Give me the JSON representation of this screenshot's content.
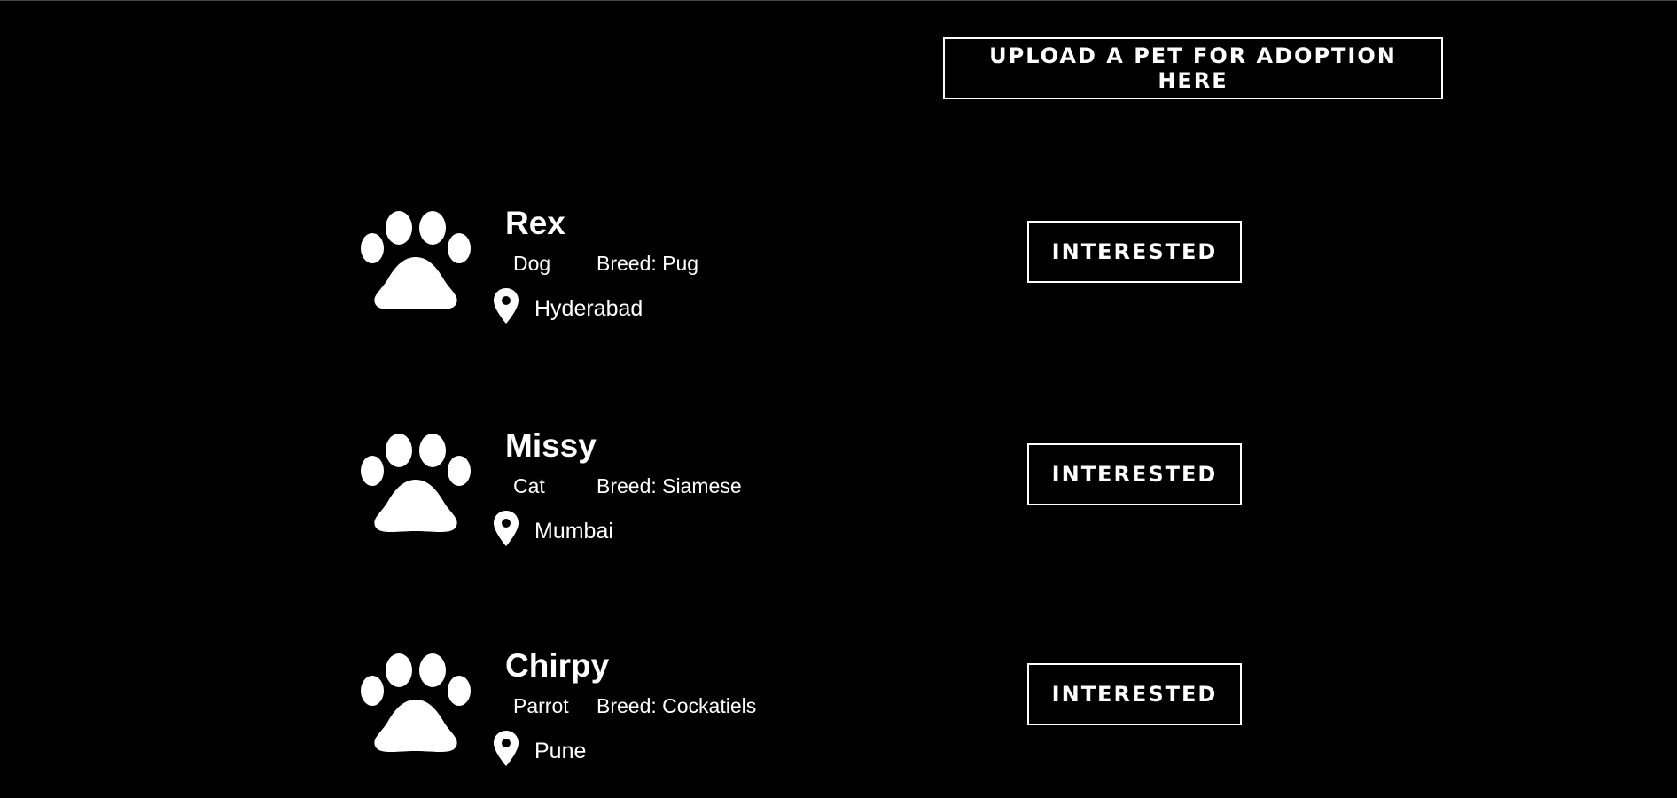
{
  "header": {
    "upload_label": "UPLOAD A PET FOR ADOPTION HERE"
  },
  "pets": [
    {
      "name": "Rex",
      "type": "Dog",
      "breed": "Breed: Pug",
      "location": "Hyderabad",
      "action_label": "INTERESTED"
    },
    {
      "name": "Missy",
      "type": "Cat",
      "breed": "Breed: Siamese",
      "location": "Mumbai",
      "action_label": "INTERESTED"
    },
    {
      "name": "Chirpy",
      "type": "Parrot",
      "breed": "Breed: Cockatiels",
      "location": "Pune",
      "action_label": "INTERESTED"
    }
  ],
  "icons": {
    "pet": "paw-icon",
    "location": "location-pin-icon"
  },
  "colors": {
    "background": "#000000",
    "foreground": "#ffffff"
  }
}
